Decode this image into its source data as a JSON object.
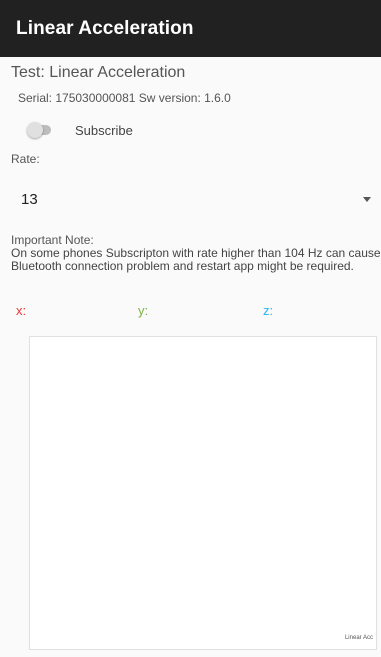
{
  "appbar": {
    "title": "Linear Acceleration"
  },
  "test": {
    "title": "Test: Linear Acceleration",
    "serial_line": "Serial: 175030000081  Sw version: 1.6.0"
  },
  "subscribe": {
    "label": "Subscribe",
    "checked": false
  },
  "rate": {
    "label": "Rate:",
    "selected": "13"
  },
  "note": {
    "title": "Important Note:",
    "text": "On some phones Subscripton with rate higher than 104 Hz can cause Bluetooth connection problem and restart app might be required."
  },
  "axes": {
    "x": "x:",
    "y": "y:",
    "z": "z:"
  },
  "colors": {
    "x": "#e53935",
    "y": "#7cb342",
    "z": "#29b6f6",
    "appbar": "#212121"
  },
  "chart": {
    "legend": "Linear Acc"
  }
}
